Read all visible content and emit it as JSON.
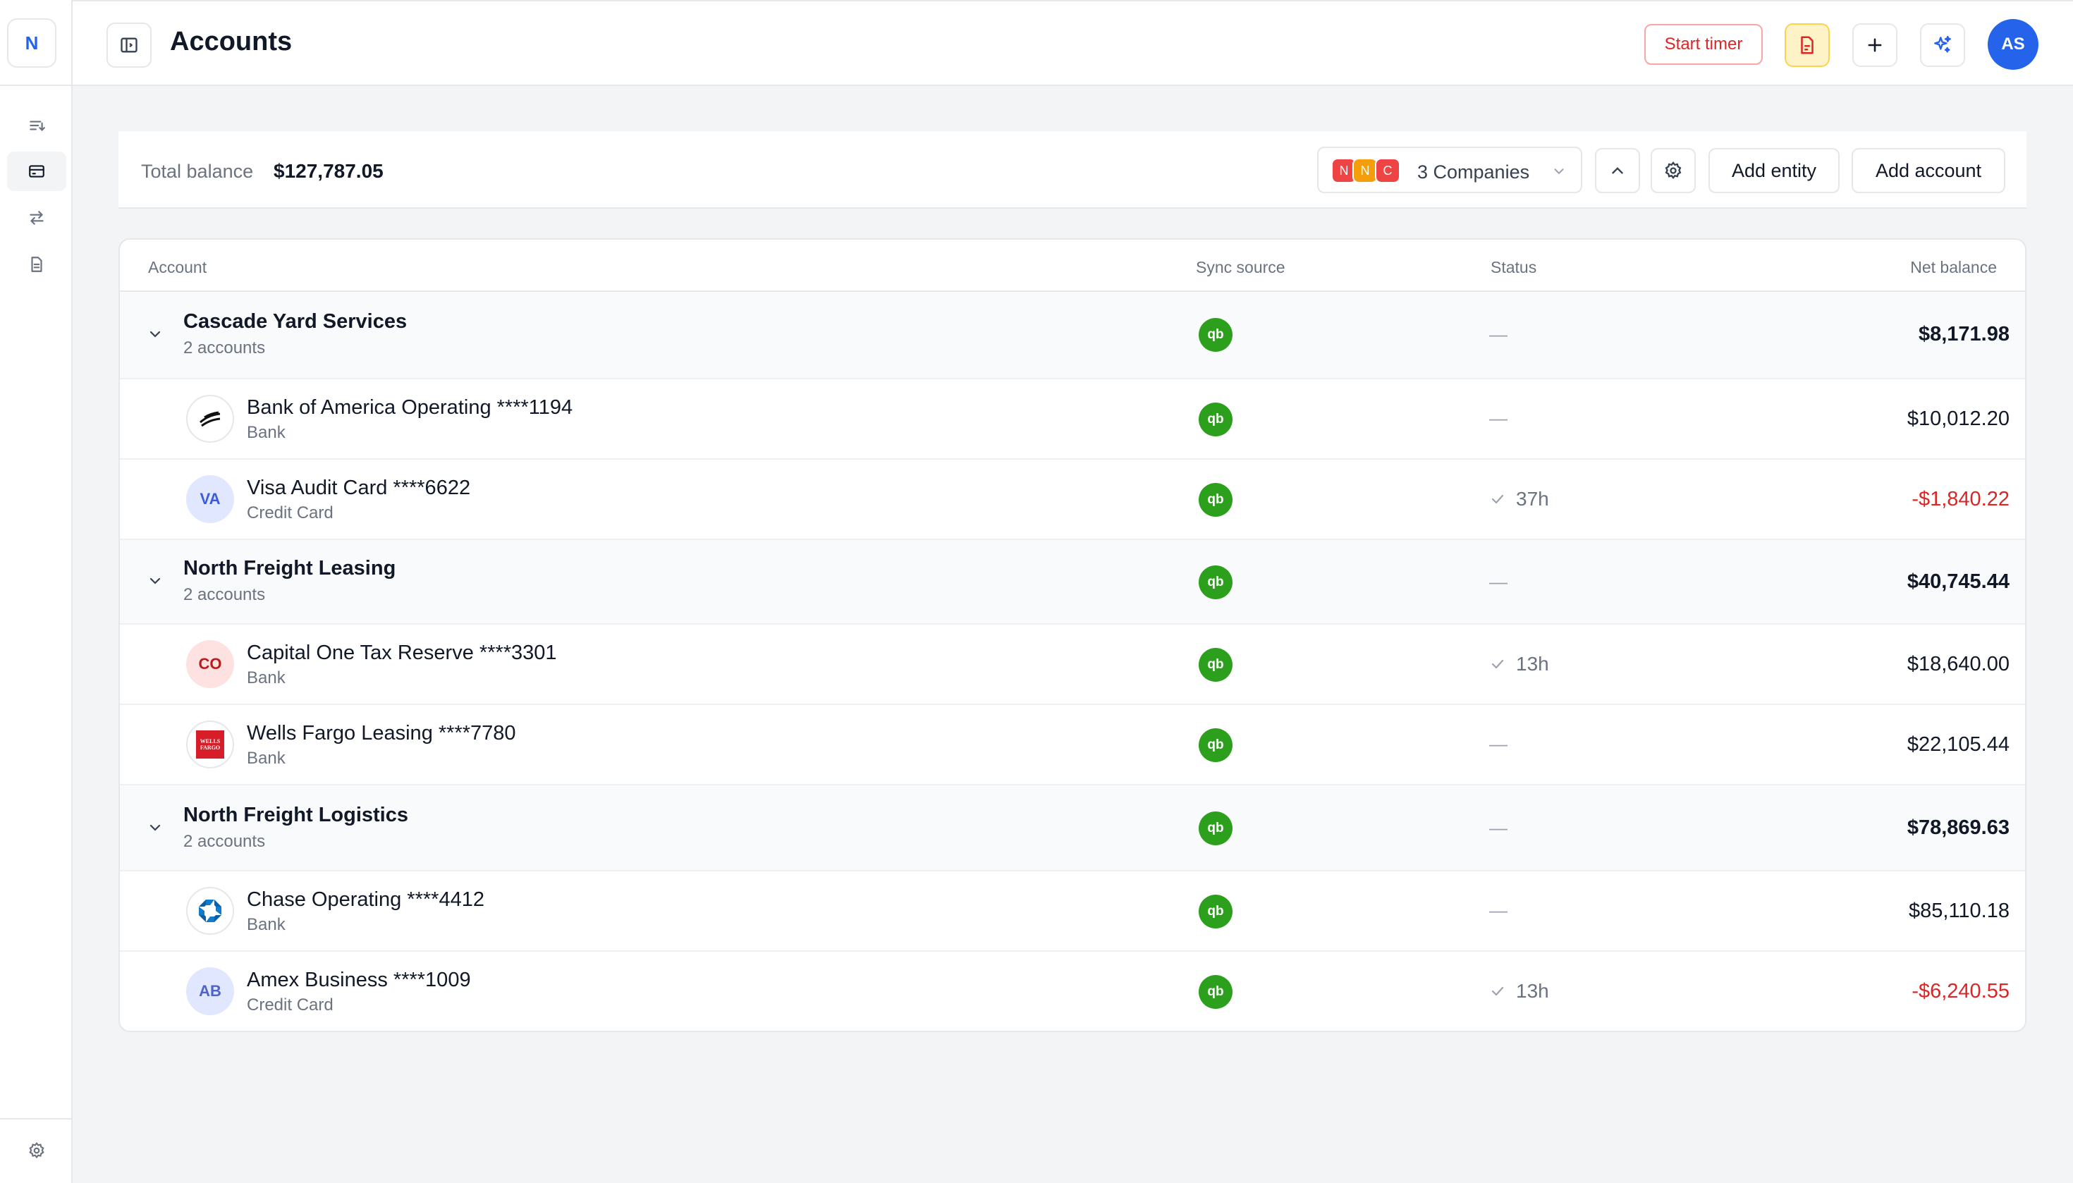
{
  "app": {
    "logo_letter": "N"
  },
  "header": {
    "title": "Accounts",
    "start_timer_label": "Start timer",
    "avatar_initials": "AS"
  },
  "balance": {
    "label": "Total balance",
    "value": "$127,787.05"
  },
  "companies": {
    "chips": [
      {
        "letter": "N",
        "color": "#ef4444"
      },
      {
        "letter": "N",
        "color": "#f59e0b"
      },
      {
        "letter": "C",
        "color": "#ef4444"
      }
    ],
    "label": "3 Companies"
  },
  "toolbar": {
    "add_entity_label": "Add entity",
    "add_account_label": "Add account"
  },
  "table": {
    "headers": {
      "account": "Account",
      "sync_source": "Sync source",
      "status": "Status",
      "net_balance": "Net balance"
    },
    "sync_badge": "qb",
    "dash": "—",
    "groups": [
      {
        "name": "Cascade Yard Services",
        "sub": "2 accounts",
        "status": "—",
        "balance": "$8,171.98",
        "accounts": [
          {
            "name": "Bank of America Operating ****1194",
            "type": "Bank",
            "logo": "boa",
            "initials": "",
            "status": "—",
            "balance": "$10,012.20",
            "negative": false
          },
          {
            "name": "Visa Audit Card ****6622",
            "type": "Credit Card",
            "logo": "initials",
            "initials": "VA",
            "status": "37h",
            "balance": "-$1,840.22",
            "negative": true
          }
        ]
      },
      {
        "name": "North Freight Leasing",
        "sub": "2 accounts",
        "status": "—",
        "balance": "$40,745.44",
        "accounts": [
          {
            "name": "Capital One Tax Reserve ****3301",
            "type": "Bank",
            "logo": "initials",
            "initials": "CO",
            "status": "13h",
            "balance": "$18,640.00",
            "negative": false
          },
          {
            "name": "Wells Fargo Leasing ****7780",
            "type": "Bank",
            "logo": "wellsfargo",
            "initials": "WELLS FARGO",
            "status": "—",
            "balance": "$22,105.44",
            "negative": false
          }
        ]
      },
      {
        "name": "North Freight Logistics",
        "sub": "2 accounts",
        "status": "—",
        "balance": "$78,869.63",
        "accounts": [
          {
            "name": "Chase Operating ****4412",
            "type": "Bank",
            "logo": "chase",
            "initials": "",
            "status": "—",
            "balance": "$85,110.18",
            "negative": false
          },
          {
            "name": "Amex Business ****1009",
            "type": "Credit Card",
            "logo": "initials",
            "initials": "AB",
            "status": "13h",
            "balance": "-$6,240.55",
            "negative": true
          }
        ]
      }
    ]
  },
  "colors": {
    "accent": "#2563eb",
    "negative": "#dc2626",
    "quickbooks": "#2ca01c"
  }
}
